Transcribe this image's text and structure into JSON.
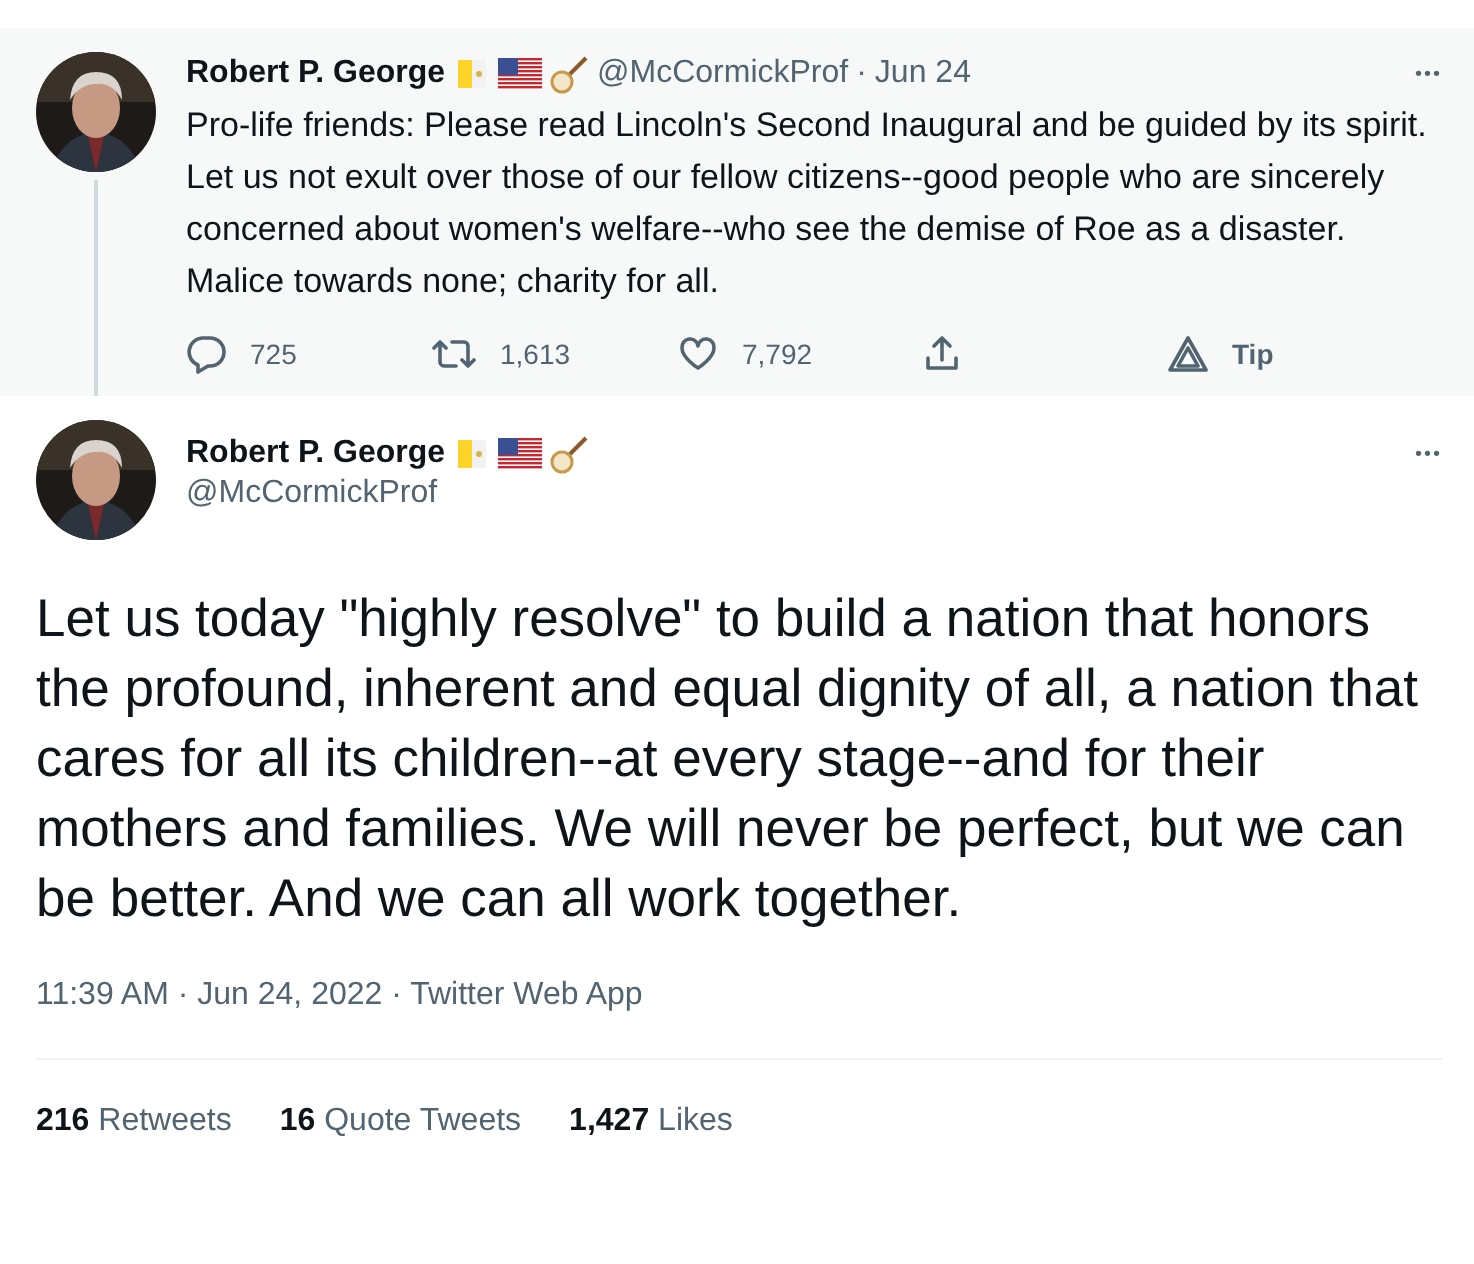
{
  "parent_tweet": {
    "name": "Robert P. George",
    "handle": "@McCormickProf",
    "date": "Jun 24",
    "separator": "·",
    "more": "•••",
    "text": "Pro-life friends: Please read Lincoln's Second Inaugural and be guided by its spirit. Let us not exult over those of our fellow citizens--good people who are sincerely concerned about women's welfare--who see the demise of Roe as a disaster. Malice towards none; charity for all.",
    "actions": [
      {
        "kind": "reply",
        "count": "725"
      },
      {
        "kind": "retweet",
        "count": "1,613"
      },
      {
        "kind": "like",
        "count": "7,792"
      },
      {
        "kind": "share"
      },
      {
        "kind": "tip",
        "count": "Tip"
      }
    ]
  },
  "main_tweet": {
    "name": "Robert P. George",
    "handle": "@McCormickProf",
    "more": "•••",
    "text": "Let us today \"highly resolve\" to build a nation that honors the profound, inherent and equal dignity of all, a nation that cares for all its children--at every stage--and for their mothers and families. We will never be perfect, but we can be better. And we can all work together.",
    "meta": "11:39 AM · Jun 24, 2022 · Twitter Web App",
    "stats": [
      {
        "count": "216",
        "label": "Retweets"
      },
      {
        "count": "16",
        "label": "Quote Tweets"
      },
      {
        "count": "1,427",
        "label": "Likes"
      }
    ]
  }
}
